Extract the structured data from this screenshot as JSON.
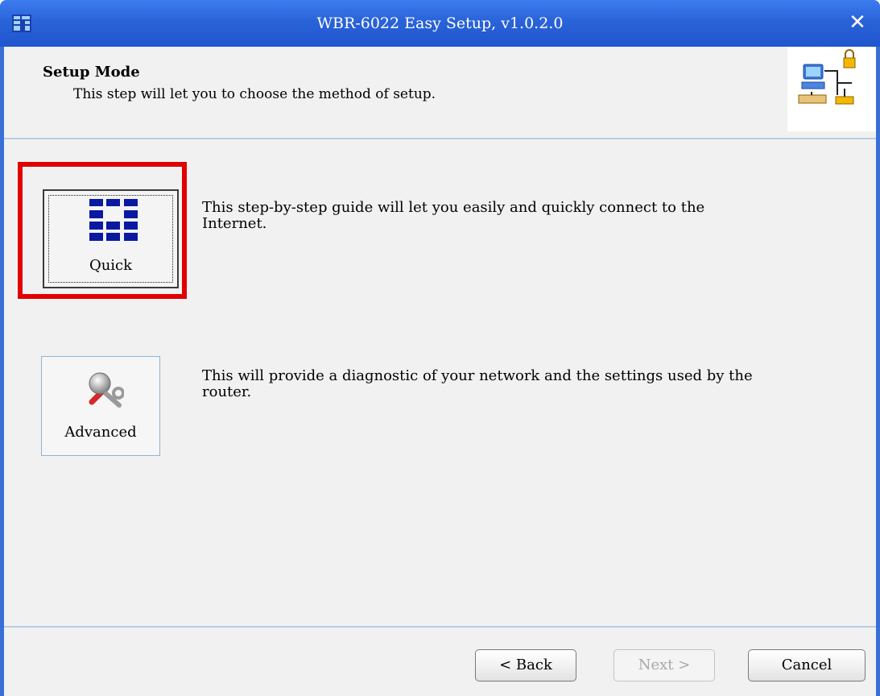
{
  "window": {
    "title": "WBR-6022 Easy Setup, v1.0.2.0",
    "close_glyph": "✕"
  },
  "header": {
    "title": "Setup Mode",
    "description": "This step will let you to choose the method of setup."
  },
  "options": {
    "quick": {
      "label": "Quick",
      "icon": "levelone-logo-icon",
      "description": "This step-by-step guide will let you easily and quickly connect to the Internet.",
      "highlighted": true
    },
    "advanced": {
      "label": "Advanced",
      "icon": "wrench-tools-icon",
      "description": "This will provide a diagnostic of your network and the settings used by the router."
    }
  },
  "nav": {
    "back": "< Back",
    "next": "Next >",
    "next_disabled": true,
    "cancel": "Cancel"
  },
  "colors": {
    "titlebar": "#2a62d8",
    "highlight_border": "#e00000",
    "logo_blue": "#0a1aa0"
  }
}
